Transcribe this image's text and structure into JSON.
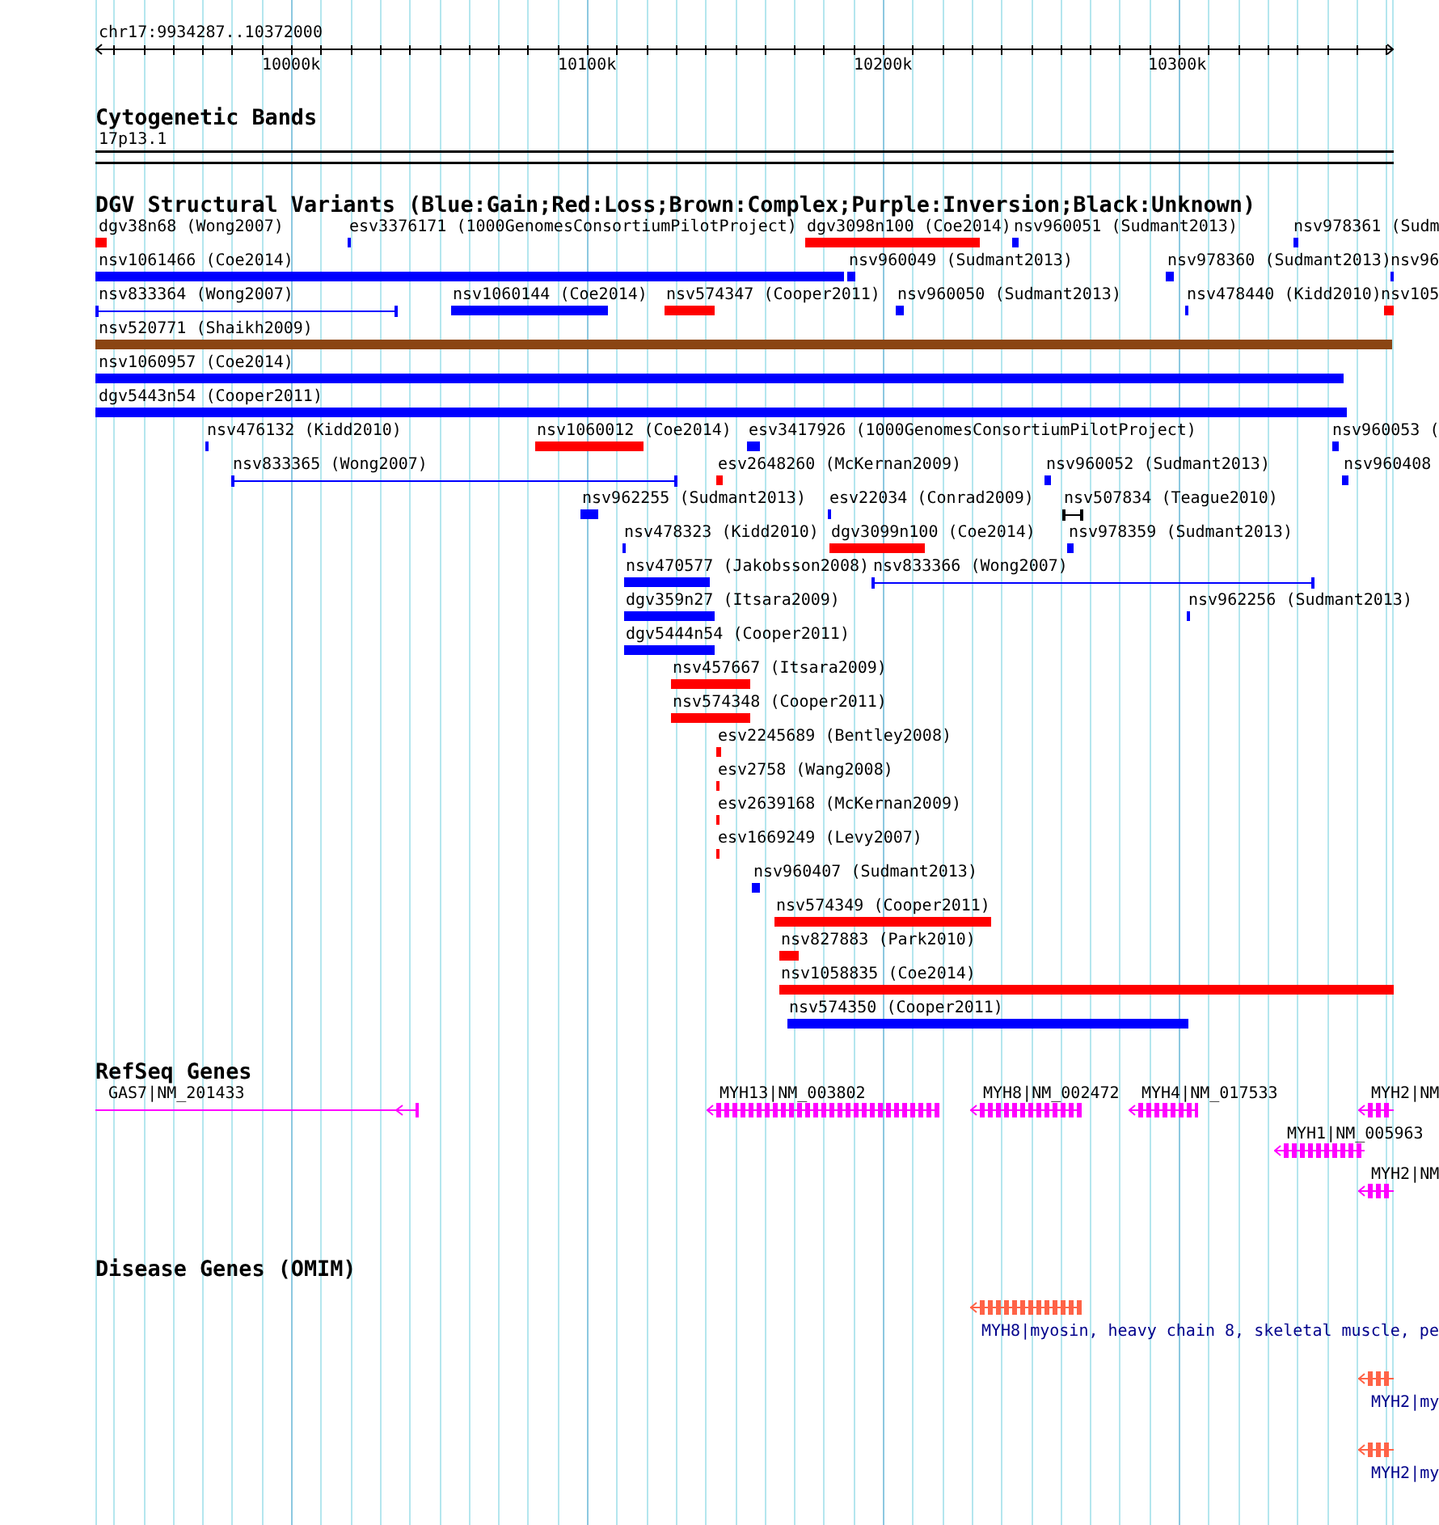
{
  "view": {
    "range_label": "chr17:9934287..10372000"
  },
  "ruler": {
    "ticks": [
      {
        "label": "10000k"
      },
      {
        "label": "10100k"
      },
      {
        "label": "10200k"
      },
      {
        "label": "10300k"
      }
    ]
  },
  "tracks": [
    {
      "kind": "cytoband",
      "title": "Cytogenetic Bands",
      "band": "17p13.1"
    },
    {
      "kind": "variants",
      "title": "DGV Structural Variants (Blue:Gain;Red:Loss;Brown:Complex;Purple:Inversion;Black:Unknown)",
      "rows": [
        {
          "features": [
            {
              "label": "dgv38n68 (Wong2007)",
              "kind": "bar",
              "color": "#ff0000"
            },
            {
              "label": "esv3376171 (1000GenomesConsortiumPilotProject)",
              "kind": "bar",
              "color": "#0000ff"
            },
            {
              "label": "dgv3098n100 (Coe2014)",
              "kind": "bar",
              "color": "#ff0000"
            },
            {
              "label": "nsv960051 (Sudmant2013)",
              "kind": "bar",
              "color": "#0000ff"
            },
            {
              "label": "nsv978361 (Sudm",
              "kind": "bar",
              "color": "#0000ff"
            }
          ]
        },
        {
          "features": [
            {
              "label": "nsv1061466 (Coe2014)",
              "kind": "bar",
              "color": "#0000ff"
            },
            {
              "label": "nsv960049 (Sudmant2013)",
              "kind": "bar",
              "color": "#0000ff"
            },
            {
              "label": "nsv978360 (Sudmant2013)",
              "kind": "bar",
              "color": "#0000ff"
            },
            {
              "label": "nsv96",
              "kind": "bar",
              "color": "#0000ff"
            }
          ]
        },
        {
          "features": [
            {
              "label": "nsv833364 (Wong2007)",
              "kind": "span",
              "color": "#0000ff"
            },
            {
              "label": "nsv1060144 (Coe2014)",
              "kind": "bar",
              "color": "#0000ff"
            },
            {
              "label": "nsv574347 (Cooper2011)",
              "kind": "bar",
              "color": "#ff0000"
            },
            {
              "label": "nsv960050 (Sudmant2013)",
              "kind": "bar",
              "color": "#0000ff"
            },
            {
              "label": "nsv478440 (Kidd2010)",
              "kind": "bar",
              "color": "#0000ff"
            },
            {
              "label": "nsv105",
              "kind": "bar",
              "color": "#ff0000"
            }
          ]
        },
        {
          "features": [
            {
              "label": "nsv520771 (Shaikh2009)",
              "kind": "bar",
              "color": "#8b4513"
            }
          ]
        },
        {
          "features": [
            {
              "label": "nsv1060957 (Coe2014)",
              "kind": "bar",
              "color": "#0000ff"
            }
          ]
        },
        {
          "features": [
            {
              "label": "dgv5443n54 (Cooper2011)",
              "kind": "bar",
              "color": "#0000ff"
            }
          ]
        },
        {
          "features": [
            {
              "label": "nsv476132 (Kidd2010)",
              "kind": "bar",
              "color": "#0000ff"
            },
            {
              "label": "nsv1060012 (Coe2014)",
              "kind": "bar",
              "color": "#ff0000"
            },
            {
              "label": "esv3417926 (1000GenomesConsortiumPilotProject)",
              "kind": "bar",
              "color": "#0000ff"
            },
            {
              "label": "nsv960053 (",
              "kind": "bar",
              "color": "#0000ff"
            }
          ]
        },
        {
          "features": [
            {
              "label": "nsv833365 (Wong2007)",
              "kind": "span",
              "color": "#0000ff"
            },
            {
              "label": "esv2648260 (McKernan2009)",
              "kind": "bar",
              "color": "#ff0000"
            },
            {
              "label": "nsv960052 (Sudmant2013)",
              "kind": "bar",
              "color": "#0000ff"
            },
            {
              "label": "nsv960408",
              "kind": "bar",
              "color": "#0000ff"
            }
          ]
        },
        {
          "features": [
            {
              "label": "nsv962255 (Sudmant2013)",
              "kind": "bar",
              "color": "#0000ff"
            },
            {
              "label": "esv22034 (Conrad2009)",
              "kind": "bar",
              "color": "#0000ff"
            },
            {
              "label": "nsv507834 (Teague2010)",
              "kind": "span",
              "color": "#000000"
            }
          ]
        },
        {
          "features": [
            {
              "label": "nsv478323 (Kidd2010)",
              "kind": "bar",
              "color": "#0000ff"
            },
            {
              "label": "dgv3099n100 (Coe2014)",
              "kind": "bar",
              "color": "#ff0000"
            },
            {
              "label": "nsv978359 (Sudmant2013)",
              "kind": "bar",
              "color": "#0000ff"
            }
          ]
        },
        {
          "features": [
            {
              "label": "nsv470577 (Jakobsson2008)",
              "kind": "bar",
              "color": "#0000ff"
            },
            {
              "label": "nsv833366 (Wong2007)",
              "kind": "span",
              "color": "#0000ff"
            }
          ]
        },
        {
          "features": [
            {
              "label": "dgv359n27 (Itsara2009)",
              "kind": "bar",
              "color": "#0000ff"
            },
            {
              "label": "nsv962256 (Sudmant2013)",
              "kind": "bar",
              "color": "#0000ff"
            }
          ]
        },
        {
          "features": [
            {
              "label": "dgv5444n54 (Cooper2011)",
              "kind": "bar",
              "color": "#0000ff"
            }
          ]
        },
        {
          "features": [
            {
              "label": "nsv457667 (Itsara2009)",
              "kind": "bar",
              "color": "#ff0000"
            }
          ]
        },
        {
          "features": [
            {
              "label": "nsv574348 (Cooper2011)",
              "kind": "bar",
              "color": "#ff0000"
            }
          ]
        },
        {
          "features": [
            {
              "label": "esv2245689 (Bentley2008)",
              "kind": "bar",
              "color": "#ff0000"
            }
          ]
        },
        {
          "features": [
            {
              "label": "esv2758 (Wang2008)",
              "kind": "bar",
              "color": "#ff0000"
            }
          ]
        },
        {
          "features": [
            {
              "label": "esv2639168 (McKernan2009)",
              "kind": "bar",
              "color": "#ff0000"
            }
          ]
        },
        {
          "features": [
            {
              "label": "esv1669249 (Levy2007)",
              "kind": "bar",
              "color": "#ff0000"
            }
          ]
        },
        {
          "features": [
            {
              "label": "nsv960407 (Sudmant2013)",
              "kind": "bar",
              "color": "#0000ff"
            }
          ]
        },
        {
          "features": [
            {
              "label": "nsv574349 (Cooper2011)",
              "kind": "bar",
              "color": "#ff0000"
            }
          ]
        },
        {
          "features": [
            {
              "label": "nsv827883 (Park2010)",
              "kind": "bar",
              "color": "#ff0000"
            }
          ]
        },
        {
          "features": [
            {
              "label": "nsv1058835 (Coe2014)",
              "kind": "bar",
              "color": "#ff0000"
            }
          ]
        },
        {
          "features": [
            {
              "label": "nsv574350 (Cooper2011)",
              "kind": "bar",
              "color": "#0000ff"
            }
          ]
        }
      ]
    },
    {
      "kind": "genes",
      "title": "RefSeq Genes",
      "rows": [
        {
          "features": [
            {
              "label": "GAS7|NM_201433"
            },
            {
              "label": "MYH13|NM_003802"
            },
            {
              "label": "MYH8|NM_002472"
            },
            {
              "label": "MYH4|NM_017533"
            },
            {
              "label": "MYH2|NM"
            }
          ]
        },
        {
          "features": [
            {
              "label": "MYH1|NM_005963"
            }
          ]
        },
        {
          "features": [
            {
              "label": "MYH2|NM"
            }
          ]
        }
      ]
    },
    {
      "kind": "disease",
      "title": "Disease Genes (OMIM)",
      "rows": [
        {
          "features": [
            {
              "label": "MYH8|myosin, heavy chain 8, skeletal muscle, pe"
            }
          ]
        },
        {
          "features": [
            {
              "label": "MYH2|my"
            }
          ]
        },
        {
          "features": [
            {
              "label": "MYH2|my"
            }
          ]
        }
      ]
    }
  ]
}
